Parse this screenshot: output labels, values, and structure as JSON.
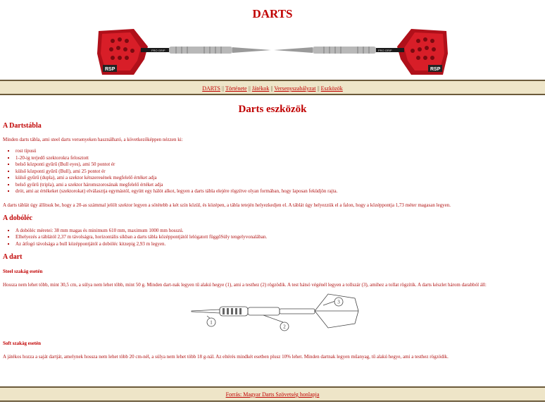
{
  "site": {
    "title": "DARTS"
  },
  "banner": {
    "left_brand": "PRO GRIP",
    "right_brand": "PRO GRIP",
    "left_logo": "RSP",
    "right_logo": "RSP"
  },
  "nav": {
    "items": [
      "DARTS",
      "Története",
      "Játékok",
      "Versenyszabályzat",
      "Eszközök"
    ],
    "separator": "||"
  },
  "page": {
    "heading": "Darts eszközök"
  },
  "board": {
    "heading": "A Dartstábla",
    "intro": "Minden darts tábla, ami steel darts versenyeken használható, a következőképpen nézzen ki:",
    "items": [
      "rost típusú",
      "1-20-ig terjedő szektorokra felosztott",
      "belső központi gyűrű (Bull eyes), ami 50 pontot ér",
      "külső központi gyűrű (Bull), ami 25 pontot ér",
      "külső gyűrű (dupla), ami a szektor kétszeresének megfelelő értéket adja",
      "belső gyűrű (tripla), ami a szektor háromszorosának megfelelő értéket adja",
      "drót, ami az értékeket (szektorokat) elválasztja egymástól, együtt egy hálót alkot, legyen a darts tábla elejére rögzítve olyan formában, hogy laposan feküdjön rajta."
    ],
    "note": "A darts táblát úgy állítsuk be, hogy a 20-as számmal jelölt szektor legyen a sötétebb a két szín közül, és középen, a tábla tetején helyezkedjen el. A táblát úgy helyezzük el a falon, hogy a középpontja 1,73 méter magasan legyen."
  },
  "oche": {
    "heading": "A dobóléc",
    "items": [
      "A dobóléc méretei: 38 mm magas és minimum 610 mm, maximum 1000 mm hosszú.",
      "Elhelyezés a táblától 2,37 m távolságra, horizontális síkban a darts tábla középpontjától lelógatott függőSúly tengelyvonalában.",
      "Az átfogó távolsága a bull középpontjától a dobóléc kitzepig 2,93 m legyen."
    ]
  },
  "dart": {
    "heading": "A dart",
    "steel_heading": "Steel szakág esetén",
    "steel_text": "Hossza nem lehet több, mint 30,5 cm, a súlya nem lehet több, mint 50 g. Minden dart-nak legyen tű alakú hegye (1), ami a testhez (2) rögzödik. A test hátsó végénél legyen a tollszár (3), amihez a tollat rögzítik. A darts készlet három darabból áll:",
    "diagram_labels": [
      "1",
      "2",
      "3"
    ],
    "soft_heading": "Soft szakág esetén",
    "soft_text": "A játékos hozza a saját dartját, amelynek hossza nem lehet több 20 cm-nél, a súlya nem lehet több 18 g-nál. Az eltérés mindkét esetben plusz 10% lehet. Minden dartnak legyen műanyag, tű alakú hegye, ami a testhez rögzödik."
  },
  "footer": {
    "link_text": "Forrás: Magyar Darts Szövetség honlapja"
  },
  "colors": {
    "accent": "#c00000",
    "bar_bg": "#eee5c8",
    "bar_border": "#6b5a3a",
    "flight_red": "#c8101a"
  }
}
